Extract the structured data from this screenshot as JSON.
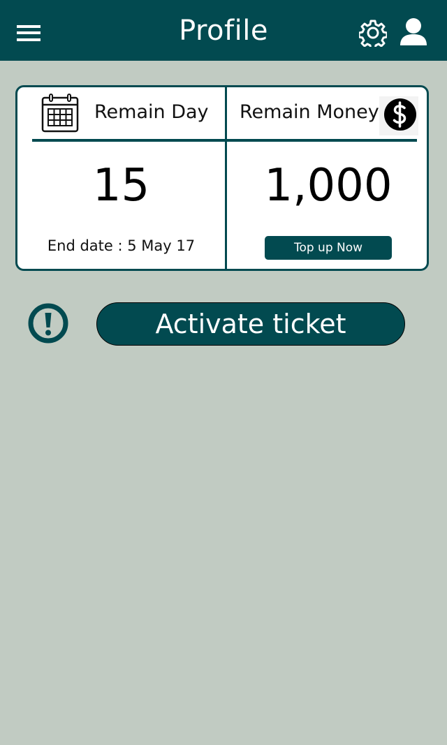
{
  "header": {
    "title": "Profile",
    "menu_icon": "hamburger-menu-icon",
    "settings_icon": "gear-icon",
    "profile_icon": "user-icon"
  },
  "remain_card": {
    "day": {
      "icon": "calendar-icon",
      "label": "Remain Day",
      "value": "15",
      "end_date_text": "End date : 5 May 17"
    },
    "money": {
      "icon": "dollar-icon",
      "label": "Remain Money",
      "value": "1,000",
      "topup_label": "Top up Now"
    }
  },
  "ticket": {
    "alert_icon": "exclamation-icon",
    "activate_label": "Activate ticket"
  },
  "colors": {
    "primary": "#024a50",
    "background": "#c1cbc2",
    "card": "#ffffff"
  }
}
